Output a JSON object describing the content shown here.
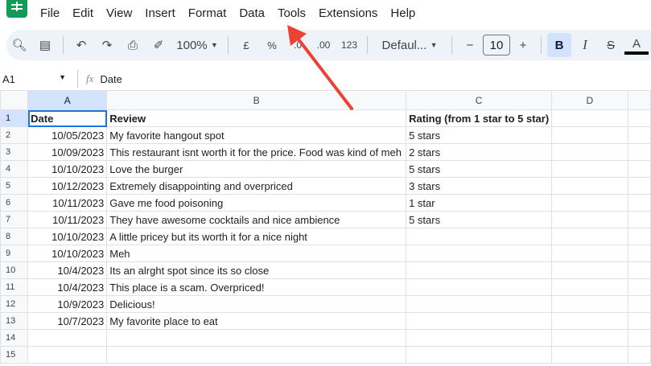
{
  "menu": [
    "File",
    "Edit",
    "View",
    "Insert",
    "Format",
    "Data",
    "Tools",
    "Extensions",
    "Help"
  ],
  "toolbar": {
    "zoom": "100%",
    "currency": "£",
    "percent": "%",
    "dec_less": ".0",
    "dec_more": ".00",
    "format_123": "123",
    "font": "Defaul...",
    "font_size": "10",
    "bold": "B",
    "italic": "I",
    "strike": "S",
    "text_color": "A"
  },
  "formula_bar": {
    "cell_ref": "A1",
    "fx": "fx",
    "value": "Date"
  },
  "columns": [
    "A",
    "B",
    "C",
    "D"
  ],
  "rows": [
    [
      "Date",
      "Review",
      "Rating (from 1 star to 5 star)",
      ""
    ],
    [
      "10/05/2023",
      "My favorite hangout spot",
      "5 stars",
      ""
    ],
    [
      "10/09/2023",
      "This restaurant isnt worth it for the price. Food was kind of meh",
      "2 stars",
      ""
    ],
    [
      "10/10/2023",
      "Love the burger",
      "5 stars",
      ""
    ],
    [
      "10/12/2023",
      "Extremely disappointing and overpriced",
      "3 stars",
      ""
    ],
    [
      "10/11/2023",
      "Gave me food poisoning",
      "1 star",
      ""
    ],
    [
      "10/11/2023",
      "They have awesome cocktails and nice ambience",
      "5 stars",
      ""
    ],
    [
      "10/10/2023",
      "A little pricey but its worth it for a nice night",
      "",
      ""
    ],
    [
      "10/10/2023",
      "Meh",
      "",
      ""
    ],
    [
      "10/4/2023",
      "Its an alrght spot since its so close",
      "",
      ""
    ],
    [
      "10/4/2023",
      "This place is a scam. Overpriced!",
      "",
      ""
    ],
    [
      "10/9/2023",
      "Delicious!",
      "",
      ""
    ],
    [
      "10/7/2023",
      "My favorite place to eat",
      "",
      ""
    ],
    [
      "",
      "",
      "",
      ""
    ],
    [
      "",
      "",
      "",
      ""
    ]
  ],
  "annotation_color": "#ea4335"
}
